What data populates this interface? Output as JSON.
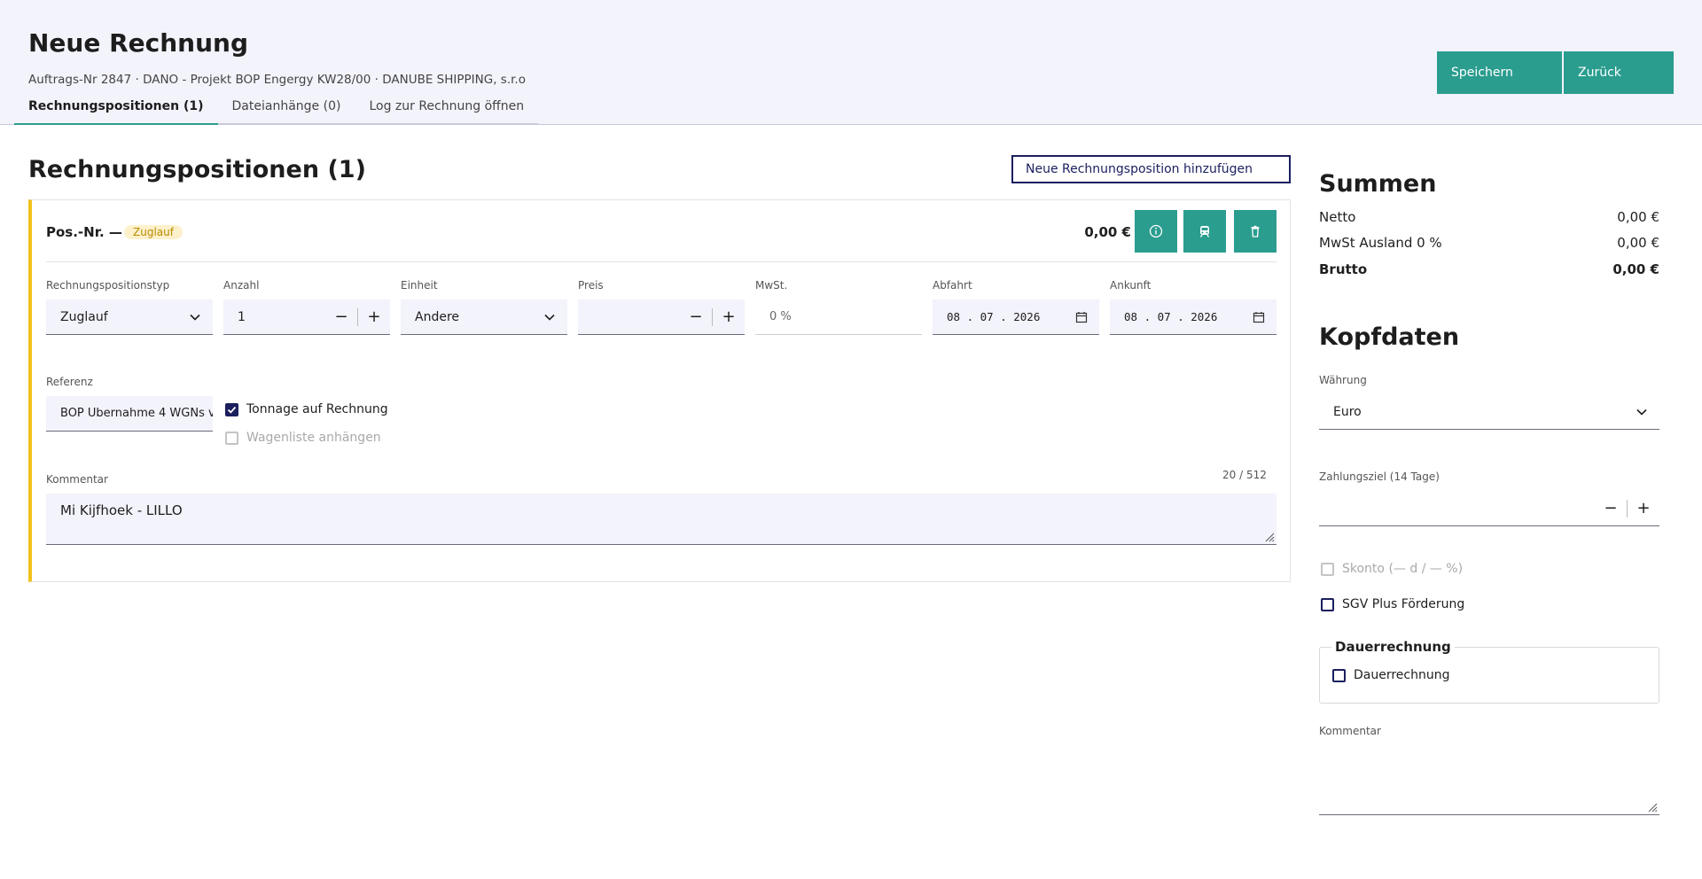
{
  "header": {
    "title": "Neue Rechnung",
    "subtitle": "Auftrags-Nr 2847 · DANO - Projekt BOP Engergy KW28/00 · DANUBE SHIPPING, s.r.o",
    "tabs": [
      {
        "label": "Rechnungspositionen (1)"
      },
      {
        "label": "Dateianhänge (0)"
      },
      {
        "label": "Log zur Rechnung öffnen"
      }
    ],
    "save_label": "Speichern",
    "back_label": "Zurück"
  },
  "positions": {
    "title": "Rechnungspositionen (1)",
    "add_label": "Neue Rechnungsposition hinzufügen",
    "card": {
      "pos_label": "Pos.-Nr. —",
      "badge": "Zuglauf",
      "total": "0,00 €",
      "accent_color": "#f2c21b",
      "icons": [
        "info-icon",
        "train-icon",
        "delete-icon"
      ],
      "fields": {
        "type_label": "Rechnungspositionstyp",
        "type_value": "Zuglauf",
        "count_label": "Anzahl",
        "count_value": "1",
        "unit_label": "Einheit",
        "unit_value": "Andere",
        "price_label": "Preis",
        "price_value": "",
        "vat_label": "MwSt.",
        "vat_value": "0 %",
        "departure_label": "Abfahrt",
        "departure_value": "08 . 07 . 2026",
        "arrival_label": "Ankunft",
        "arrival_value": "08 . 07 . 2026",
        "reference_label": "Referenz",
        "reference_value": "BOP Übernahme 4 WGNs v"
      },
      "tonnage_label": "Tonnage auf Rechnung",
      "tonnage_checked": true,
      "wagon_label": "Wagenliste anhängen",
      "comment_label": "Kommentar",
      "comment_counter": "20 / 512",
      "comment_value": "Mi Kijfhoek - LILLO"
    }
  },
  "sums": {
    "title": "Summen",
    "rows": [
      {
        "label": "Netto",
        "value": "0,00 €"
      },
      {
        "label": "MwSt Ausland 0 %",
        "value": "0,00 €"
      },
      {
        "label": "Brutto",
        "value": "0,00 €"
      }
    ]
  },
  "head_data": {
    "title": "Kopfdaten",
    "currency_label": "Währung",
    "currency_value": "Euro",
    "payment_label": "Zahlungsziel (14 Tage)",
    "payment_value": "",
    "skonto_label": "Skonto (— d / — %)",
    "sgv_label": "SGV Plus Förderung",
    "recurring_legend": "Dauerrechnung",
    "recurring_label": "Dauerrechnung",
    "comment_label": "Kommentar"
  },
  "colors": {
    "primary": "#2a9d8f",
    "navy": "#1b1f5e",
    "header_bg": "#f3f3fc"
  }
}
